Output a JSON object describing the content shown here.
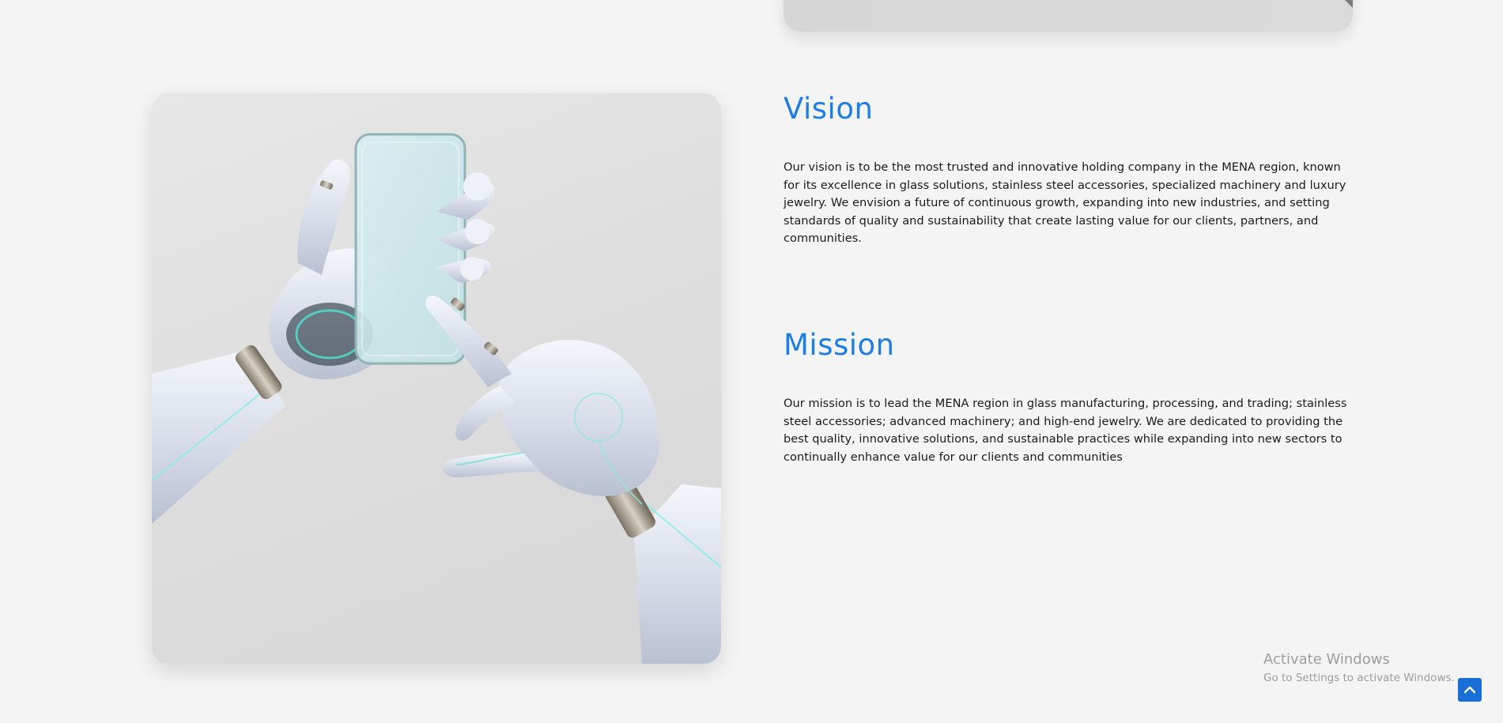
{
  "vision": {
    "title": "Vision",
    "text": "Our vision is to be the most trusted and innovative holding company in the MENA region, known for its excellence in glass solutions, stainless steel accessories, specialized machinery and luxury jewelry. We envision a future of continuous growth, expanding into new industries, and setting standards of quality and sustainability that create lasting value for our clients, partners, and communities."
  },
  "mission": {
    "title": "Mission",
    "text": "Our mission is to lead the MENA region in glass manufacturing, processing, and trading; stainless steel accessories; advanced machinery; and high-end jewelry. We are dedicated to providing the best quality, innovative solutions, and sustainable practices while expanding into new sectors to continually enhance value for our clients and communities"
  },
  "watermark": {
    "title": "Activate Windows",
    "subtitle": "Go to Settings to activate Windows."
  },
  "icons": {
    "scroll_top": "chevron-up-icon"
  },
  "colors": {
    "accent": "#1e7ee4",
    "background": "#f4f4f4",
    "body_text": "#1b1b1b",
    "scroll_button": "#1a6fd6"
  }
}
